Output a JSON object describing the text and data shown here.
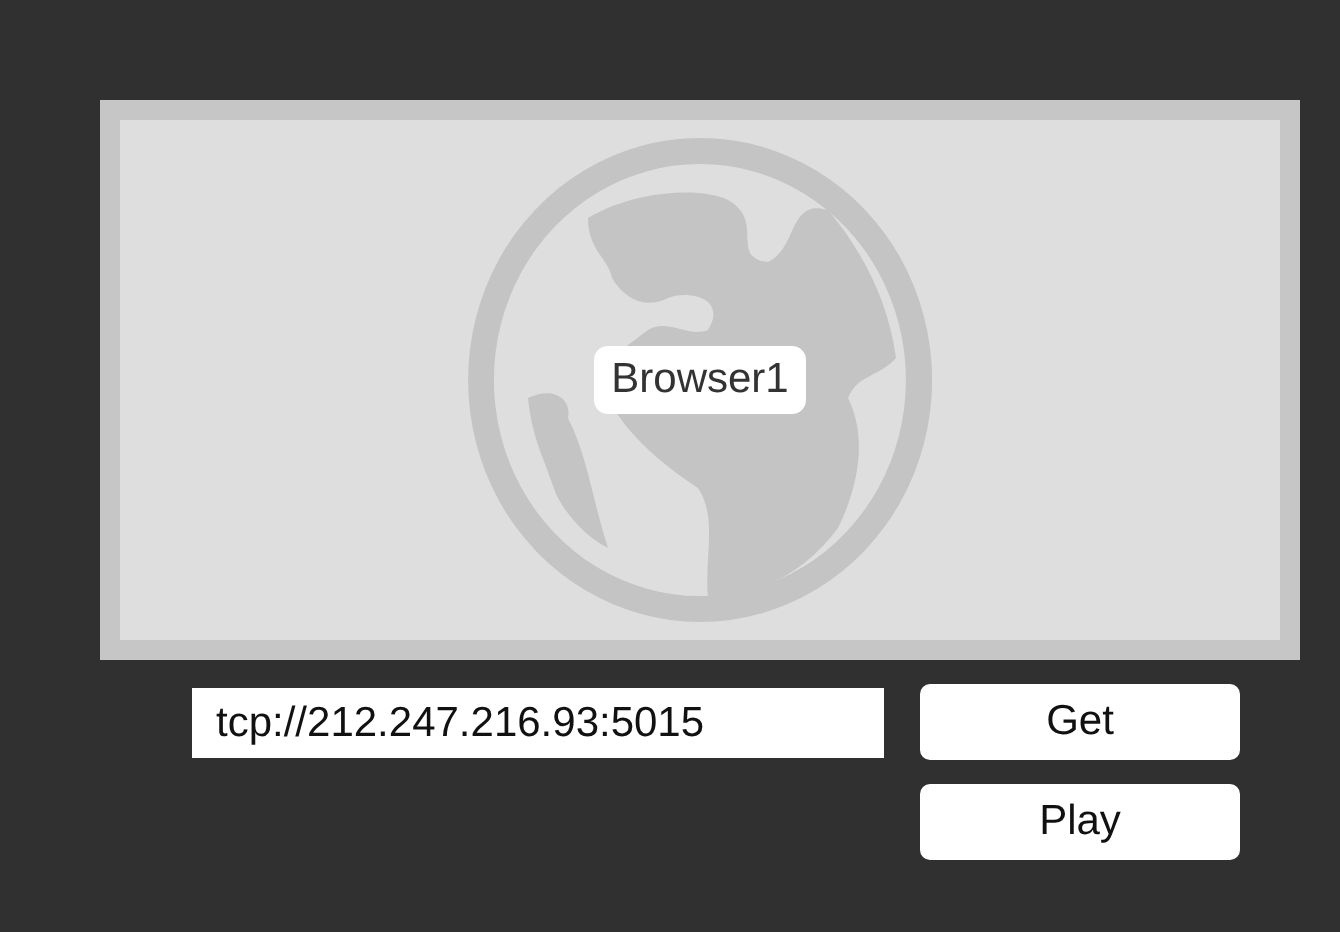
{
  "browser": {
    "label": "Browser1"
  },
  "url_field": {
    "value": "tcp://212.247.216.93:5015"
  },
  "buttons": [
    "Get",
    "Play"
  ]
}
